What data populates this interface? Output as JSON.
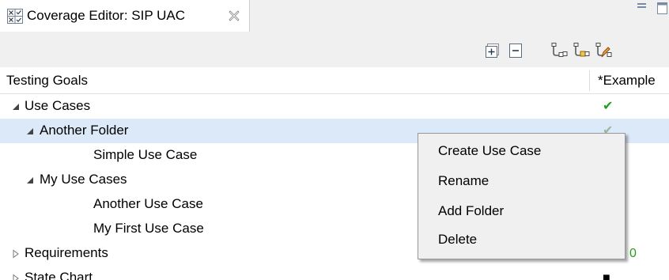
{
  "tab": {
    "title": "Coverage Editor: SIP UAC",
    "icon": "coverage-editor-icon",
    "close_icon": "close-icon"
  },
  "view": {
    "minimize_icon": "minimize-icon",
    "maximize_icon": "maximize-icon"
  },
  "toolbar": {
    "buttons": [
      {
        "icon": "expand-all-icon"
      },
      {
        "icon": "collapse-all-icon"
      },
      {
        "icon": "use-case-link-icon"
      },
      {
        "icon": "use-case-link-yellow-icon"
      },
      {
        "icon": "use-case-link-edit-icon"
      }
    ]
  },
  "columns": {
    "goals": "Testing Goals",
    "example": "*Example"
  },
  "tree": {
    "rows": [
      {
        "label": "Use Cases",
        "status": "✔"
      },
      {
        "label": "Another Folder",
        "status": "✔"
      },
      {
        "label": "Simple Use Case",
        "status": ""
      },
      {
        "label": "My Use Cases",
        "status": ""
      },
      {
        "label": "Another Use Case",
        "status": ""
      },
      {
        "label": "My First Use Case",
        "status": ""
      },
      {
        "label": "Requirements",
        "status": "0"
      },
      {
        "label": "State Chart",
        "status": "■"
      }
    ]
  },
  "context_menu": {
    "items": [
      {
        "label": "Create Use Case"
      },
      {
        "label": "Rename"
      },
      {
        "label": "Add Folder"
      },
      {
        "label": "Delete"
      }
    ]
  },
  "colors": {
    "selection": "#dbe9f8",
    "check_green": "#1ea21e",
    "check_faded": "#9ab8a0",
    "chrome": "#f0f0f0"
  }
}
